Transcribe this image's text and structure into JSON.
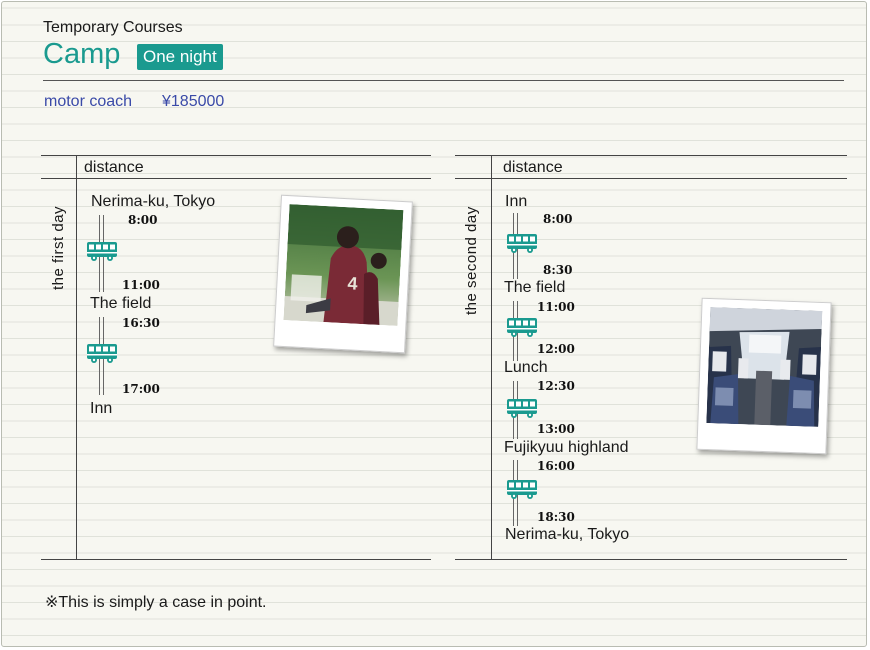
{
  "header": {
    "category": "Temporary Courses",
    "title": "Camp",
    "badge": "One night",
    "transport": "motor coach",
    "price": "¥185000"
  },
  "day1": {
    "heading": "distance",
    "label": "the first day",
    "stops": [
      {
        "place": "Nerima-ku, Tokyo",
        "depart": "8:00"
      },
      {
        "arrive": "11:00",
        "place": "The field",
        "depart": "16:30"
      },
      {
        "arrive": "17:00",
        "place": "Inn"
      }
    ]
  },
  "day2": {
    "heading": "distance",
    "label": "the second day",
    "stops": [
      {
        "place": "Inn",
        "depart": "8:00"
      },
      {
        "arrive": "8:30",
        "place": "The field",
        "depart": "11:00"
      },
      {
        "arrive": "12:00",
        "place": "Lunch",
        "depart": "12:30"
      },
      {
        "arrive": "13:00",
        "place": "Fujikyuu highland",
        "depart": "16:00"
      },
      {
        "arrive": "18:30",
        "place": "Nerima-ku, Tokyo"
      }
    ]
  },
  "footnote": "※This is simply a case in point.",
  "colors": {
    "accent": "#1a9a8f",
    "link": "#3a4aa8"
  },
  "icons": {
    "bus": "bus-icon"
  }
}
